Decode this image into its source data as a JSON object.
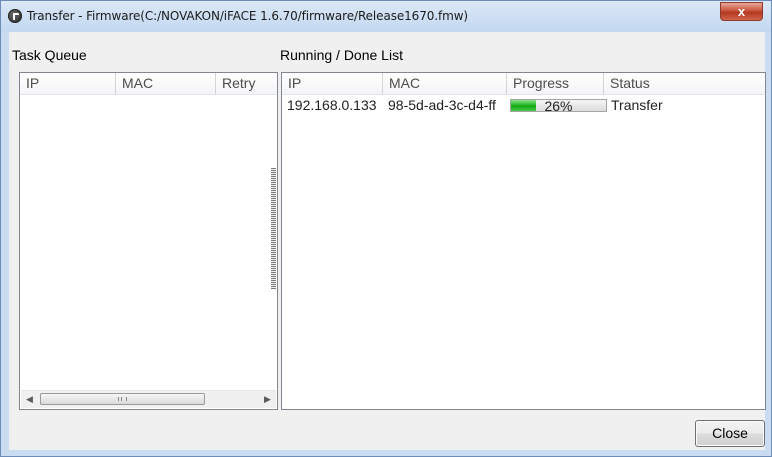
{
  "window": {
    "title": "Transfer - Firmware(C:/NOVAKON/iFACE 1.6.70/firmware/Release1670.fmw)",
    "close_glyph": "x"
  },
  "task_queue": {
    "label": "Task Queue",
    "columns": [
      "IP",
      "MAC",
      "Retry"
    ],
    "rows": [],
    "scroll_thumb_icon": "grip-icon"
  },
  "running_list": {
    "label": "Running / Done List",
    "columns": [
      "IP",
      "MAC",
      "Progress",
      "Status"
    ],
    "rows": [
      {
        "ip": "192.168.0.133",
        "mac": "98-5d-ad-3c-d4-ff",
        "progress_text": "26%",
        "progress_value": 0.26,
        "status": "Transfer"
      }
    ]
  },
  "footer": {
    "close_label": "Close"
  },
  "colors": {
    "progress_fill": "#1fb81f",
    "close_button_red": "#c8543d"
  }
}
